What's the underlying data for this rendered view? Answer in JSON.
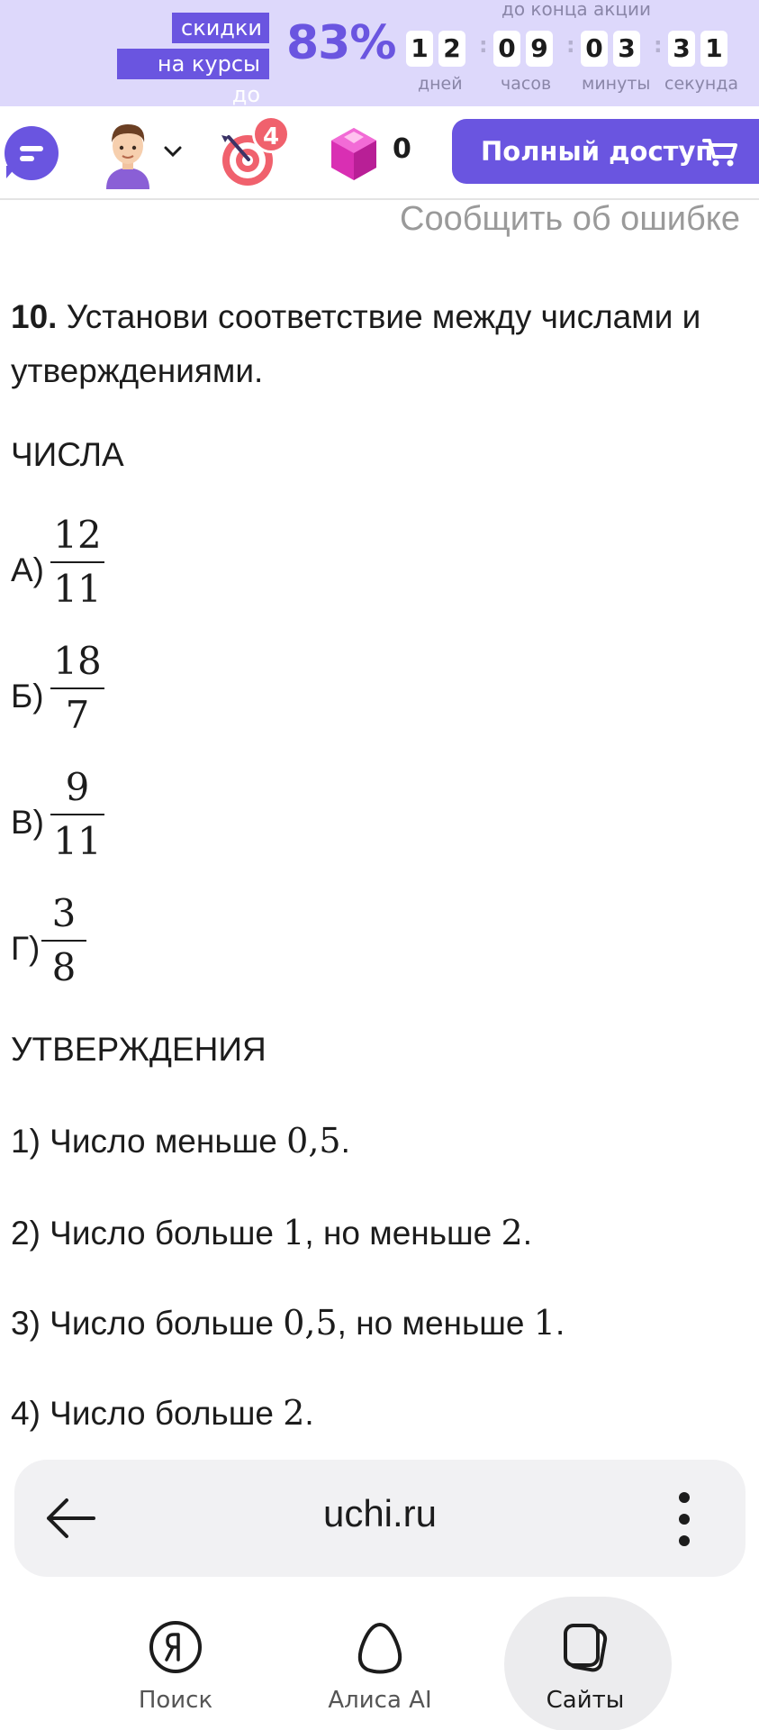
{
  "promo": {
    "label_line1": "скидки",
    "label_line2": "на курсы до",
    "percent": "83%",
    "until": "до конца акции",
    "timer": {
      "days": [
        "1",
        "2"
      ],
      "hours": [
        "0",
        "9"
      ],
      "minutes": [
        "0",
        "3"
      ],
      "seconds": [
        "3",
        "1"
      ],
      "labels": [
        "дней",
        "часов",
        "минуты",
        "секунда"
      ]
    }
  },
  "topbar": {
    "badge_count": "4",
    "gems": "0",
    "access_label": "Полный доступ"
  },
  "report_link": "Сообщить об ошибке",
  "task": {
    "number": "10.",
    "prompt": " Установи соответствие между числами и утверждениями.",
    "numbers_heading": "ЧИСЛА",
    "options": [
      {
        "letter": "А)",
        "num": "12",
        "den": "11"
      },
      {
        "letter": "Б)",
        "num": "18",
        "den": "7"
      },
      {
        "letter": "В)",
        "num": "9",
        "den": "11"
      },
      {
        "letter": "Г)",
        "num": "3",
        "den": "8"
      }
    ],
    "statements_heading": "УТВЕРЖДЕНИЯ",
    "statements": [
      {
        "prefix": "1) Число меньше ",
        "m1": "0,5",
        "mid": "",
        "m2": "",
        "suffix": "."
      },
      {
        "prefix": "2) Число больше ",
        "m1": "1",
        "mid": ", но меньше ",
        "m2": "2",
        "suffix": "."
      },
      {
        "prefix": "3) Число больше ",
        "m1": "0,5",
        "mid": ", но меньше ",
        "m2": "1",
        "suffix": "."
      },
      {
        "prefix": "4) Число больше ",
        "m1": "2",
        "mid": "",
        "m2": "",
        "suffix": "."
      }
    ]
  },
  "browser": {
    "url": "uchi.ru"
  },
  "bottom_nav": {
    "search": "Поиск",
    "alice": "Алиса AI",
    "sites": "Сайты"
  },
  "colors": {
    "brand": "#6a55e0",
    "banner_bg": "#ddd8fb",
    "badge": "#f0616d"
  }
}
